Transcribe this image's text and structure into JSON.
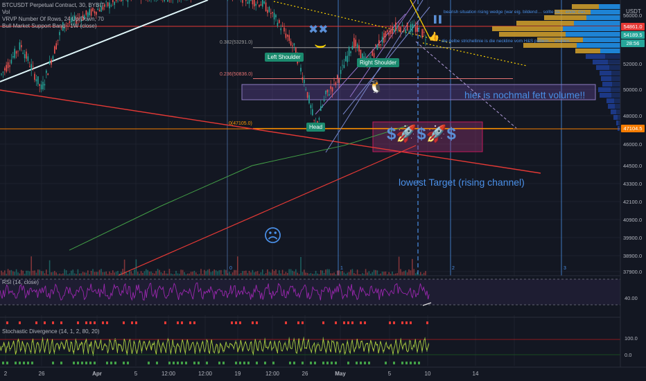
{
  "header": {
    "symbol_line": "BTCUSDT Perpetual Contract, 30, BYBIT",
    "vol_label": "Vol",
    "vrvp_label": "VRVP Number Of Rows, 24 Up/Down, 70",
    "bull_band_label": "Bull Market Support Band - 1W (close)",
    "currency": "USDT"
  },
  "price_axis": {
    "ticks": [
      "56000.0",
      "55000.0",
      "52000.0",
      "50000.0",
      "48000.0",
      "46000.0",
      "44500.0",
      "43300.0",
      "42100.0",
      "40900.0",
      "39900.0",
      "38900.0",
      "37900.0"
    ],
    "tags": [
      {
        "value": "54861.0",
        "color": "#e53935"
      },
      {
        "value": "54189.5",
        "color": "#26a69a"
      },
      {
        "value": "28:56",
        "color": "#26a69a"
      },
      {
        "value": "47104.5",
        "color": "#f57c00"
      }
    ]
  },
  "time_axis": {
    "ticks": [
      "2",
      "26",
      "Apr",
      "5",
      "12:00",
      "12:00",
      "19",
      "12:00",
      "26",
      "May",
      "5",
      "10",
      "14"
    ]
  },
  "fib_levels": [
    {
      "label": "0.382(53291.0)",
      "price": 53291.0
    },
    {
      "label": "0.236(50836.0)",
      "price": 50836.0
    },
    {
      "label": "0(47105.0)",
      "price": 47105.0
    }
  ],
  "pattern_labels": {
    "left_shoulder": "Left Shoulder",
    "head": "Head",
    "right_shoulder": "Right Shoulder"
  },
  "annotations": {
    "volume_note": "hier is nochmal fett volume!!",
    "target_note": "lowest Target (rising channel)",
    "wedge_note": "bearish situation rising wedge (war eig. bildend… sollte da… ende; das…",
    "neckline_note": "die gelbe strichellinie is die neckline vom H&S pattern… shorten.",
    "money_symbols": "$🚀$🚀$",
    "sad_face": "☹",
    "x_marks": "✖✖",
    "smile": "⌣",
    "penguin": "🐧",
    "thumbs_up": "👍",
    "pause_icon": "▌▌",
    "cycle_markers": [
      "0",
      "1",
      "2",
      "3"
    ]
  },
  "indicators": {
    "rsi_label": "RSI (14, close)",
    "rsi_tick": "40.00",
    "stoch_label": "Stochastic Divergence (14, 1, 2, 80, 20)",
    "stoch_ticks": [
      "100.0",
      "0.0"
    ]
  },
  "chart_data": {
    "type": "candlestick",
    "title": "BTCUSDT Perpetual Contract, 30, BYBIT",
    "ylabel": "USDT",
    "ylim": [
      37400,
      57000
    ],
    "y_ticks": [
      56000,
      55000,
      52000,
      50000,
      48000,
      46000,
      44500,
      43300,
      42100,
      40900,
      39900,
      38900,
      37900
    ],
    "series": [
      {
        "name": "Bull Market Support Band - 1W (close)",
        "points": [
          [
            0,
            39200
          ],
          [
            0.2,
            41800
          ],
          [
            0.4,
            44500
          ],
          [
            0.6,
            45900
          ],
          [
            0.74,
            47300
          ]
        ]
      },
      {
        "name": "Fib 0.382",
        "value": 53291.0
      },
      {
        "name": "Fib 0.236",
        "value": 50836.0
      },
      {
        "name": "Fib 0",
        "value": 47105.0
      }
    ],
    "price_levels": [
      54861.0,
      54189.5,
      47104.5
    ],
    "pattern": {
      "type": "head-and-shoulders",
      "left_shoulder": 53100,
      "head": 47105,
      "right_shoulder": 51900
    },
    "rsi_ylim": [
      30,
      70
    ],
    "rsi_ticks": [
      40
    ],
    "stoch_ticks": [
      100,
      0
    ]
  }
}
